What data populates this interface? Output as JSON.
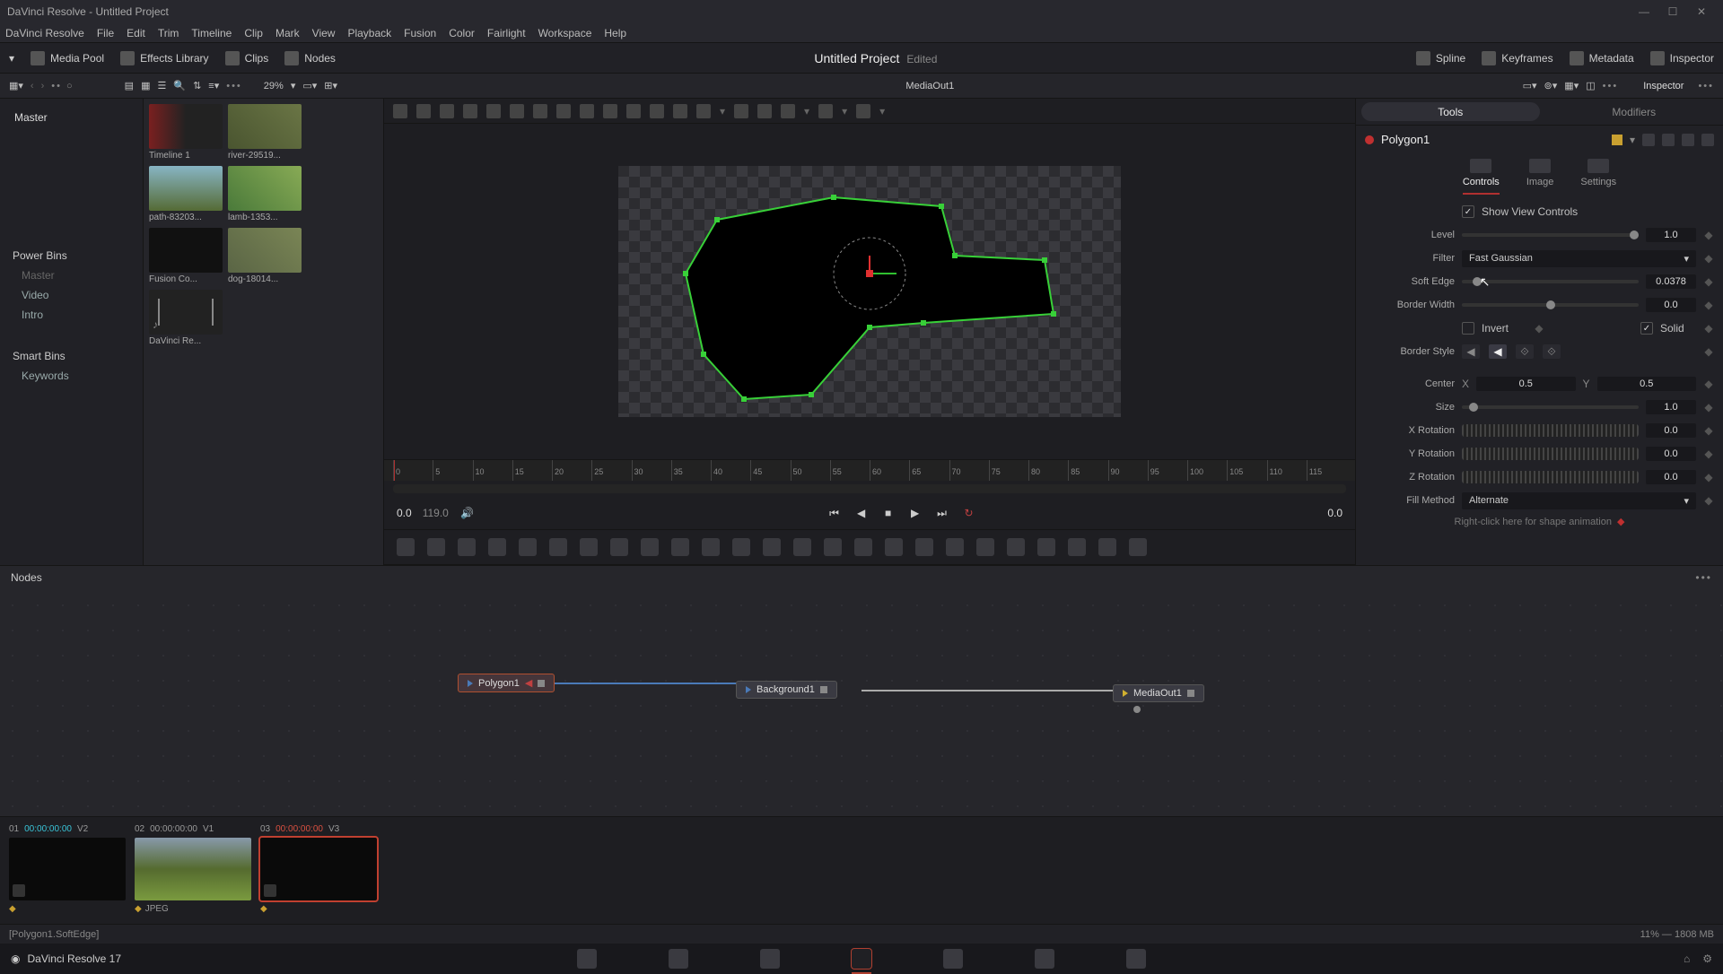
{
  "window": {
    "title": "DaVinci Resolve - Untitled Project"
  },
  "menu": [
    "DaVinci Resolve",
    "File",
    "Edit",
    "Trim",
    "Timeline",
    "Clip",
    "Mark",
    "View",
    "Playback",
    "Fusion",
    "Color",
    "Fairlight",
    "Workspace",
    "Help"
  ],
  "toptoolbar": {
    "media_pool": "Media Pool",
    "effects": "Effects Library",
    "clips": "Clips",
    "nodes": "Nodes",
    "title": "Untitled Project",
    "edited": "Edited",
    "spline": "Spline",
    "keyframes": "Keyframes",
    "metadata": "Metadata",
    "inspector": "Inspector"
  },
  "secbar": {
    "zoom": "29%",
    "viewer_label": "MediaOut1",
    "inspector": "Inspector"
  },
  "mediapool": {
    "master": "Master",
    "power_bins": "Power Bins",
    "power_items": [
      "Master",
      "Video",
      "Intro"
    ],
    "smart_bins": "Smart Bins",
    "smart_items": [
      "Keywords"
    ]
  },
  "clips": [
    {
      "label": "Timeline 1",
      "thumb": "tl"
    },
    {
      "label": "river-29519...",
      "thumb": "img1"
    },
    {
      "label": "path-83203...",
      "thumb": "img2"
    },
    {
      "label": "lamb-1353...",
      "thumb": "img3"
    },
    {
      "label": "Fusion Co...",
      "thumb": "black"
    },
    {
      "label": "dog-18014...",
      "thumb": "img4"
    },
    {
      "label": "DaVinci Re...",
      "thumb": "aud"
    }
  ],
  "ruler": [
    "0",
    "5",
    "10",
    "15",
    "20",
    "25",
    "30",
    "35",
    "40",
    "45",
    "50",
    "55",
    "60",
    "65",
    "70",
    "75",
    "80",
    "85",
    "90",
    "95",
    "100",
    "105",
    "110",
    "115"
  ],
  "transport": {
    "left": "0.0",
    "dur": "119.0",
    "right": "0.0"
  },
  "inspector": {
    "title": "Inspector",
    "tabs": {
      "tools": "Tools",
      "modifiers": "Modifiers"
    },
    "node": "Polygon1",
    "subtabs": {
      "controls": "Controls",
      "image": "Image",
      "settings": "Settings"
    },
    "show_view": "Show View Controls",
    "level": {
      "lab": "Level",
      "val": "1.0"
    },
    "filter": {
      "lab": "Filter",
      "val": "Fast Gaussian"
    },
    "softedge": {
      "lab": "Soft Edge",
      "val": "0.0378"
    },
    "borderw": {
      "lab": "Border Width",
      "val": "0.0"
    },
    "invert": {
      "lab": "Invert"
    },
    "solid": {
      "lab": "Solid"
    },
    "borderstyle": {
      "lab": "Border Style"
    },
    "center": {
      "lab": "Center",
      "x": "X",
      "xv": "0.5",
      "y": "Y",
      "yv": "0.5"
    },
    "size": {
      "lab": "Size",
      "val": "1.0"
    },
    "xrot": {
      "lab": "X Rotation",
      "val": "0.0"
    },
    "yrot": {
      "lab": "Y Rotation",
      "val": "0.0"
    },
    "zrot": {
      "lab": "Z Rotation",
      "val": "0.0"
    },
    "fill": {
      "lab": "Fill Method",
      "val": "Alternate"
    },
    "hint": "Right-click here for shape animation"
  },
  "nodes": {
    "head": "Nodes",
    "n1": "Polygon1",
    "n2": "Background1",
    "n3": "MediaOut1"
  },
  "clipstrip": {
    "c1": {
      "n": "01",
      "tc": "00:00:00:00",
      "v": "V2"
    },
    "c2": {
      "n": "02",
      "tc": "00:00:00:00",
      "v": "V1"
    },
    "c3": {
      "n": "03",
      "tc": "00:00:00:00",
      "v": "V3"
    },
    "jpeg": "JPEG"
  },
  "status": {
    "left": "[Polygon1.SoftEdge]",
    "right": "11% — 1808 MB"
  },
  "bottom": {
    "app": "DaVinci Resolve 17"
  }
}
